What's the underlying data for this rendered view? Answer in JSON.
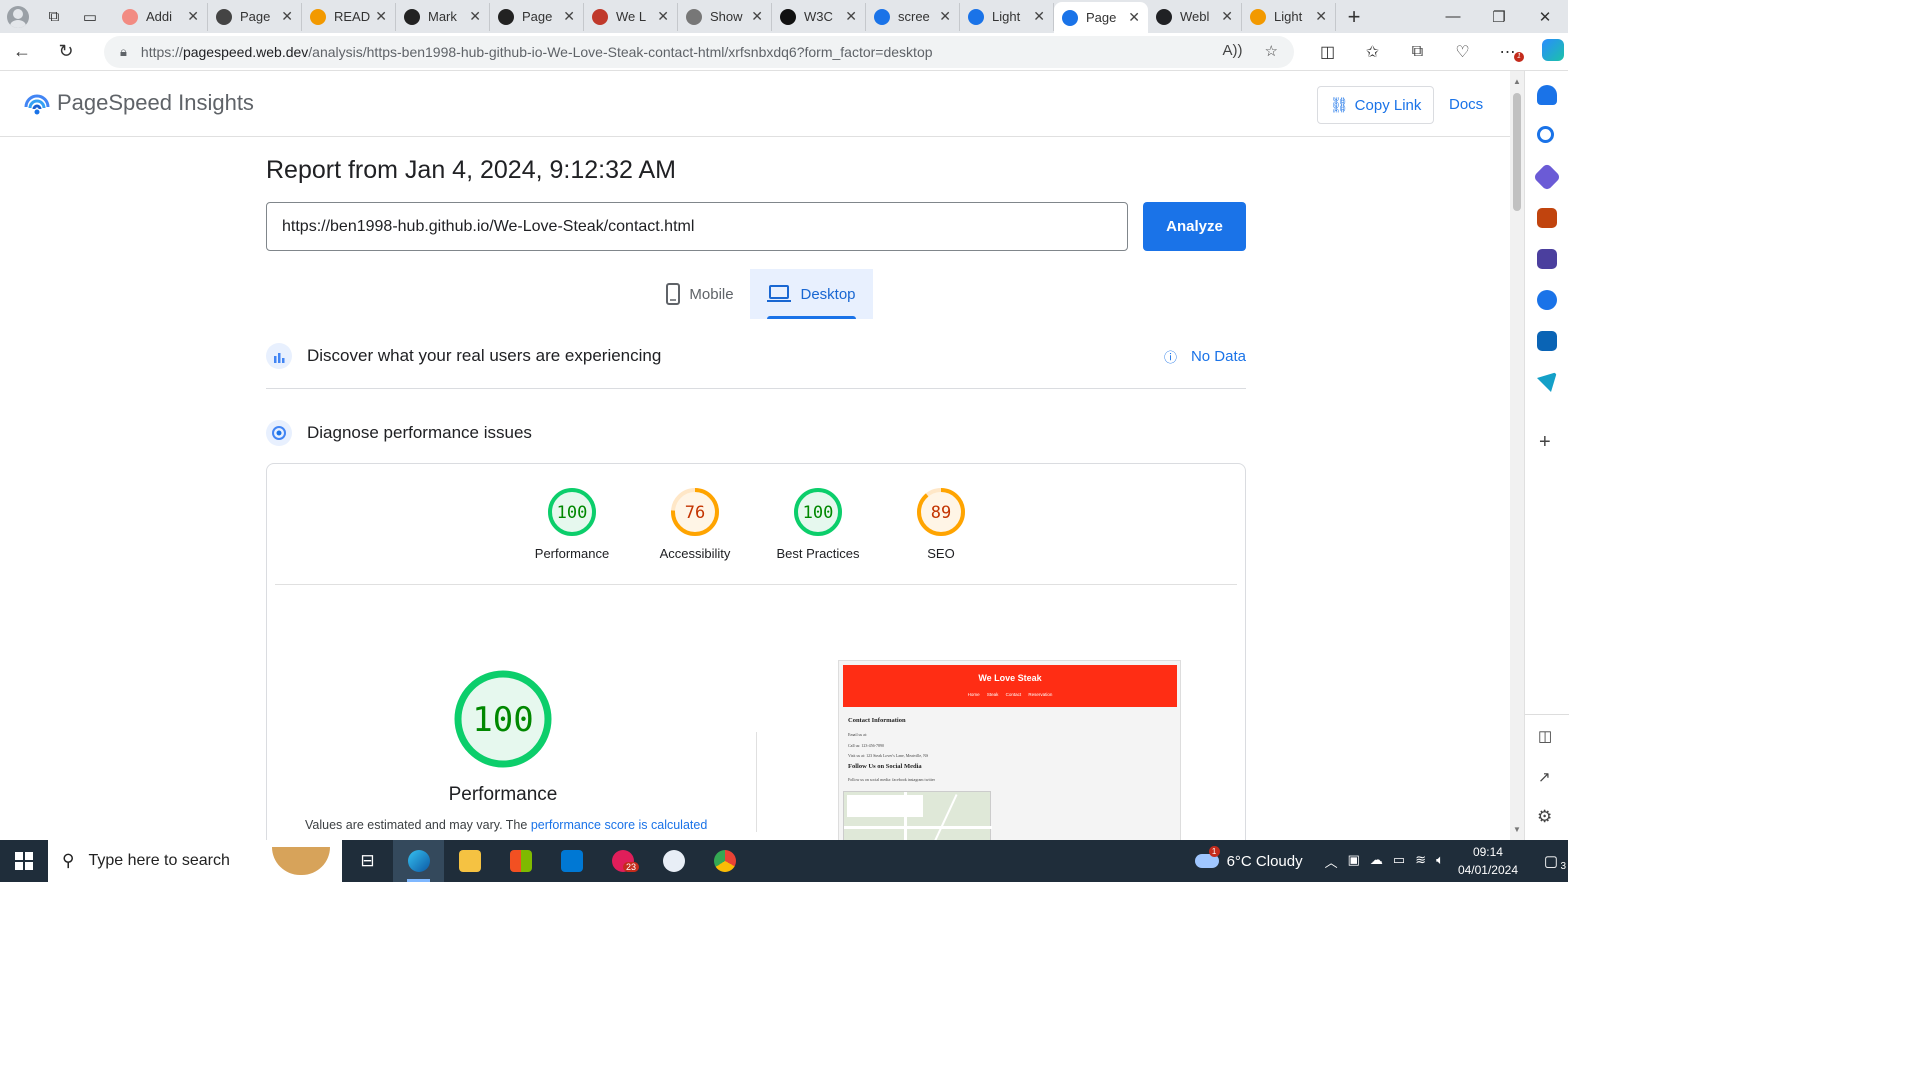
{
  "browser": {
    "tabs": [
      {
        "title": "Addi",
        "color": "#f28b82"
      },
      {
        "title": "Page",
        "color": "#444444"
      },
      {
        "title": "READ",
        "color": "#f29900"
      },
      {
        "title": "Mark",
        "color": "#222222"
      },
      {
        "title": "Page",
        "color": "#222222"
      },
      {
        "title": "We L",
        "color": "#c0392b"
      },
      {
        "title": "Show",
        "color": "#777777"
      },
      {
        "title": "W3C",
        "color": "#111111"
      },
      {
        "title": "scree",
        "color": "#1a73e8"
      },
      {
        "title": "Light",
        "color": "#1a73e8"
      },
      {
        "title": "Page",
        "color": "#1a73e8"
      },
      {
        "title": "Webl",
        "color": "#202124"
      },
      {
        "title": "Light",
        "color": "#f29900"
      }
    ],
    "active_tab_index": 10,
    "address": {
      "prefix": "https://",
      "host": "pagespeed.web.dev",
      "path": "/analysis/https-ben1998-hub-github-io-We-Love-Steak-contact-html/xrfsnbxdq6?form_factor=desktop"
    },
    "notification_count": "1"
  },
  "psi": {
    "brand": "PageSpeed Insights",
    "copy_link": "Copy Link",
    "docs": "Docs",
    "report_title": "Report from Jan 4, 2024, 9:12:32 AM",
    "url_value": "https://ben1998-hub.github.io/We-Love-Steak/contact.html",
    "analyze": "Analyze",
    "device_tabs": {
      "mobile": "Mobile",
      "desktop": "Desktop"
    },
    "discover": "Discover what your real users are experiencing",
    "no_data": "No Data",
    "diagnose": "Diagnose performance issues",
    "scores": [
      {
        "label": "Performance",
        "value": 100,
        "color": "#0cce6b",
        "text_color": "#008800"
      },
      {
        "label": "Accessibility",
        "value": 76,
        "color": "#ffa400",
        "text_color": "#c33300"
      },
      {
        "label": "Best Practices",
        "value": 100,
        "color": "#0cce6b",
        "text_color": "#008800"
      },
      {
        "label": "SEO",
        "value": 89,
        "color": "#ffa400",
        "text_color": "#c33300"
      }
    ],
    "performance_big": {
      "value": "100",
      "label": "Performance"
    },
    "values_note": "Values are estimated and may vary. The ",
    "values_link": "performance score is calculated",
    "screenshot": {
      "brand": "We Love Steak",
      "nav": "Home Steak Contact Reservation",
      "h1": "Contact Information",
      "p1": "Email us at:",
      "p2": "Call us: 123-456-7890",
      "p3": "Visit us at: 123 Steak Lover's Lane, Meatville, NS",
      "h2": "Follow Us on Social Media",
      "p4": "Follow us on social media: facebook instagram twitter"
    }
  },
  "taskbar": {
    "search_placeholder": "Type here to search",
    "weather": "6°C  Cloudy",
    "weather_badge": "1",
    "time": "09:14",
    "date": "04/01/2024",
    "notification_badge": "3",
    "chat_badge": "23"
  }
}
